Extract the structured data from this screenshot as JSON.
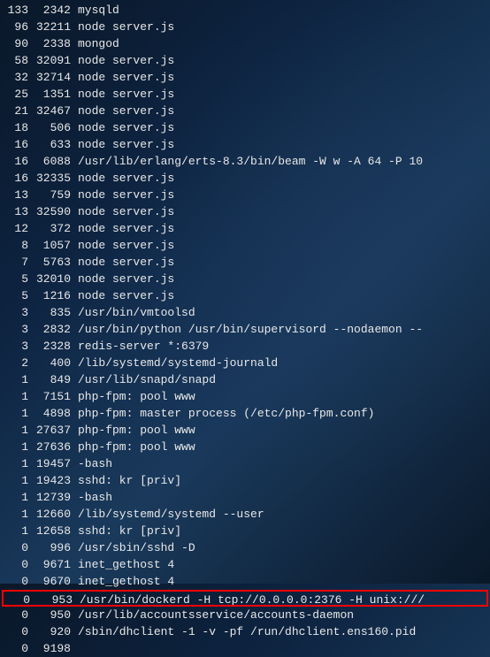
{
  "processes": [
    {
      "cpu": "133",
      "pid": "2342",
      "cmd": "mysqld",
      "highlight": false
    },
    {
      "cpu": "96",
      "pid": "32211",
      "cmd": "node server.js",
      "highlight": false
    },
    {
      "cpu": "90",
      "pid": "2338",
      "cmd": "mongod",
      "highlight": false
    },
    {
      "cpu": "58",
      "pid": "32091",
      "cmd": "node server.js",
      "highlight": false
    },
    {
      "cpu": "32",
      "pid": "32714",
      "cmd": "node server.js",
      "highlight": false
    },
    {
      "cpu": "25",
      "pid": "1351",
      "cmd": "node server.js",
      "highlight": false
    },
    {
      "cpu": "21",
      "pid": "32467",
      "cmd": "node server.js",
      "highlight": false
    },
    {
      "cpu": "18",
      "pid": "506",
      "cmd": "node server.js",
      "highlight": false
    },
    {
      "cpu": "16",
      "pid": "633",
      "cmd": "node server.js",
      "highlight": false
    },
    {
      "cpu": "16",
      "pid": "6088",
      "cmd": "/usr/lib/erlang/erts-8.3/bin/beam -W w -A 64 -P 10",
      "highlight": false
    },
    {
      "cpu": "16",
      "pid": "32335",
      "cmd": "node server.js",
      "highlight": false
    },
    {
      "cpu": "13",
      "pid": "759",
      "cmd": "node server.js",
      "highlight": false
    },
    {
      "cpu": "13",
      "pid": "32590",
      "cmd": "node server.js",
      "highlight": false
    },
    {
      "cpu": "12",
      "pid": "372",
      "cmd": "node server.js",
      "highlight": false
    },
    {
      "cpu": "8",
      "pid": "1057",
      "cmd": "node server.js",
      "highlight": false
    },
    {
      "cpu": "7",
      "pid": "5763",
      "cmd": "node server.js",
      "highlight": false
    },
    {
      "cpu": "5",
      "pid": "32010",
      "cmd": "node server.js",
      "highlight": false
    },
    {
      "cpu": "5",
      "pid": "1216",
      "cmd": "node server.js",
      "highlight": false
    },
    {
      "cpu": "3",
      "pid": "835",
      "cmd": "/usr/bin/vmtoolsd",
      "highlight": false
    },
    {
      "cpu": "3",
      "pid": "2832",
      "cmd": "/usr/bin/python /usr/bin/supervisord --nodaemon --",
      "highlight": false
    },
    {
      "cpu": "3",
      "pid": "2328",
      "cmd": "redis-server *:6379",
      "highlight": false
    },
    {
      "cpu": "2",
      "pid": "400",
      "cmd": "/lib/systemd/systemd-journald",
      "highlight": false
    },
    {
      "cpu": "1",
      "pid": "849",
      "cmd": "/usr/lib/snapd/snapd",
      "highlight": false
    },
    {
      "cpu": "1",
      "pid": "7151",
      "cmd": "php-fpm: pool www",
      "highlight": false
    },
    {
      "cpu": "1",
      "pid": "4898",
      "cmd": "php-fpm: master process (/etc/php-fpm.conf)",
      "highlight": false
    },
    {
      "cpu": "1",
      "pid": "27637",
      "cmd": "php-fpm: pool www",
      "highlight": false
    },
    {
      "cpu": "1",
      "pid": "27636",
      "cmd": "php-fpm: pool www",
      "highlight": false
    },
    {
      "cpu": "1",
      "pid": "19457",
      "cmd": "-bash",
      "highlight": false
    },
    {
      "cpu": "1",
      "pid": "19423",
      "cmd": "sshd: kr [priv]",
      "highlight": false
    },
    {
      "cpu": "1",
      "pid": "12739",
      "cmd": "-bash",
      "highlight": false
    },
    {
      "cpu": "1",
      "pid": "12660",
      "cmd": "/lib/systemd/systemd --user",
      "highlight": false
    },
    {
      "cpu": "1",
      "pid": "12658",
      "cmd": "sshd: kr [priv]",
      "highlight": false
    },
    {
      "cpu": "0",
      "pid": "996",
      "cmd": "/usr/sbin/sshd -D",
      "highlight": false
    },
    {
      "cpu": "0",
      "pid": "9671",
      "cmd": "inet_gethost 4",
      "highlight": false
    },
    {
      "cpu": "0",
      "pid": "9670",
      "cmd": "inet_gethost 4",
      "highlight": false
    },
    {
      "cpu": "0",
      "pid": "953",
      "cmd": "/usr/bin/dockerd -H tcp://0.0.0.0:2376 -H unix:///",
      "highlight": true
    },
    {
      "cpu": "0",
      "pid": "950",
      "cmd": "/usr/lib/accountsservice/accounts-daemon",
      "highlight": false
    },
    {
      "cpu": "0",
      "pid": "920",
      "cmd": "/sbin/dhclient -1 -v -pf /run/dhclient.ens160.pid",
      "highlight": false
    },
    {
      "cpu": "0",
      "pid": "9198",
      "cmd": "",
      "highlight": false
    }
  ]
}
